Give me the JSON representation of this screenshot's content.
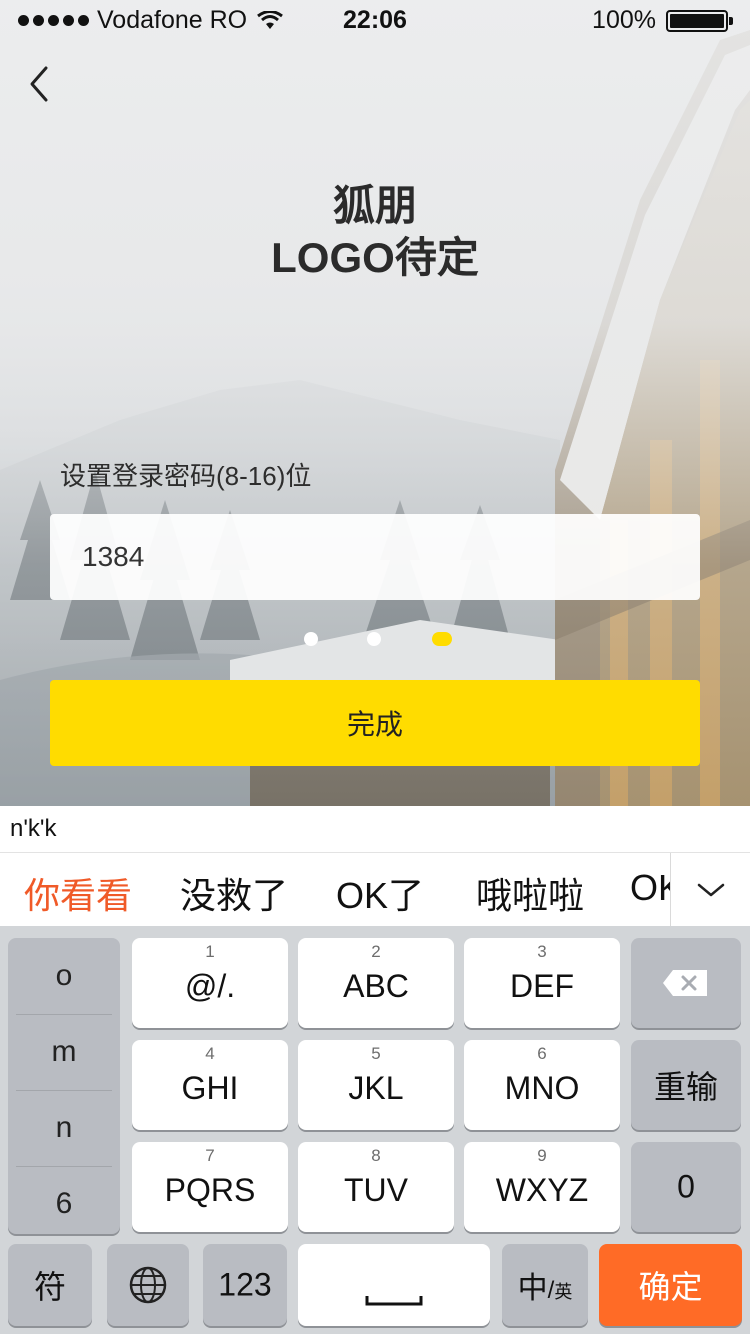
{
  "status_bar": {
    "carrier": "Vodafone RO",
    "time": "22:06",
    "battery": "100%",
    "battery_level": 1.0
  },
  "header": {
    "logo_line1": "狐朋",
    "logo_line2": "LOGO待定"
  },
  "form": {
    "label": "设置登录密码(8-16)位",
    "password_value": "1384",
    "step_current": 3,
    "step_total": 3,
    "submit_label": "完成"
  },
  "ime": {
    "composing": "n'k'k",
    "candidates": [
      "你看看",
      "没救了",
      "OK了",
      "哦啦啦",
      "OK"
    ],
    "side_column": [
      "o",
      "m",
      "n",
      "6"
    ],
    "keys": [
      {
        "num": "1",
        "letters": "@/."
      },
      {
        "num": "2",
        "letters": "ABC"
      },
      {
        "num": "3",
        "letters": "DEF"
      },
      {
        "num": "4",
        "letters": "GHI"
      },
      {
        "num": "5",
        "letters": "JKL"
      },
      {
        "num": "6",
        "letters": "MNO"
      },
      {
        "num": "7",
        "letters": "PQRS"
      },
      {
        "num": "8",
        "letters": "TUV"
      },
      {
        "num": "9",
        "letters": "WXYZ"
      }
    ],
    "reenter_label": "重输",
    "zero_label": "0",
    "symbol_label": "符",
    "numbers_label": "123",
    "lang_label_main": "中",
    "lang_label_sub": "英",
    "confirm_label": "确定",
    "accent_color": "#ff6b26",
    "candidate_highlight_color": "#f05a28"
  },
  "colors": {
    "primary_button": "#ffdc00",
    "active_step_dot": "#ffdc00"
  }
}
